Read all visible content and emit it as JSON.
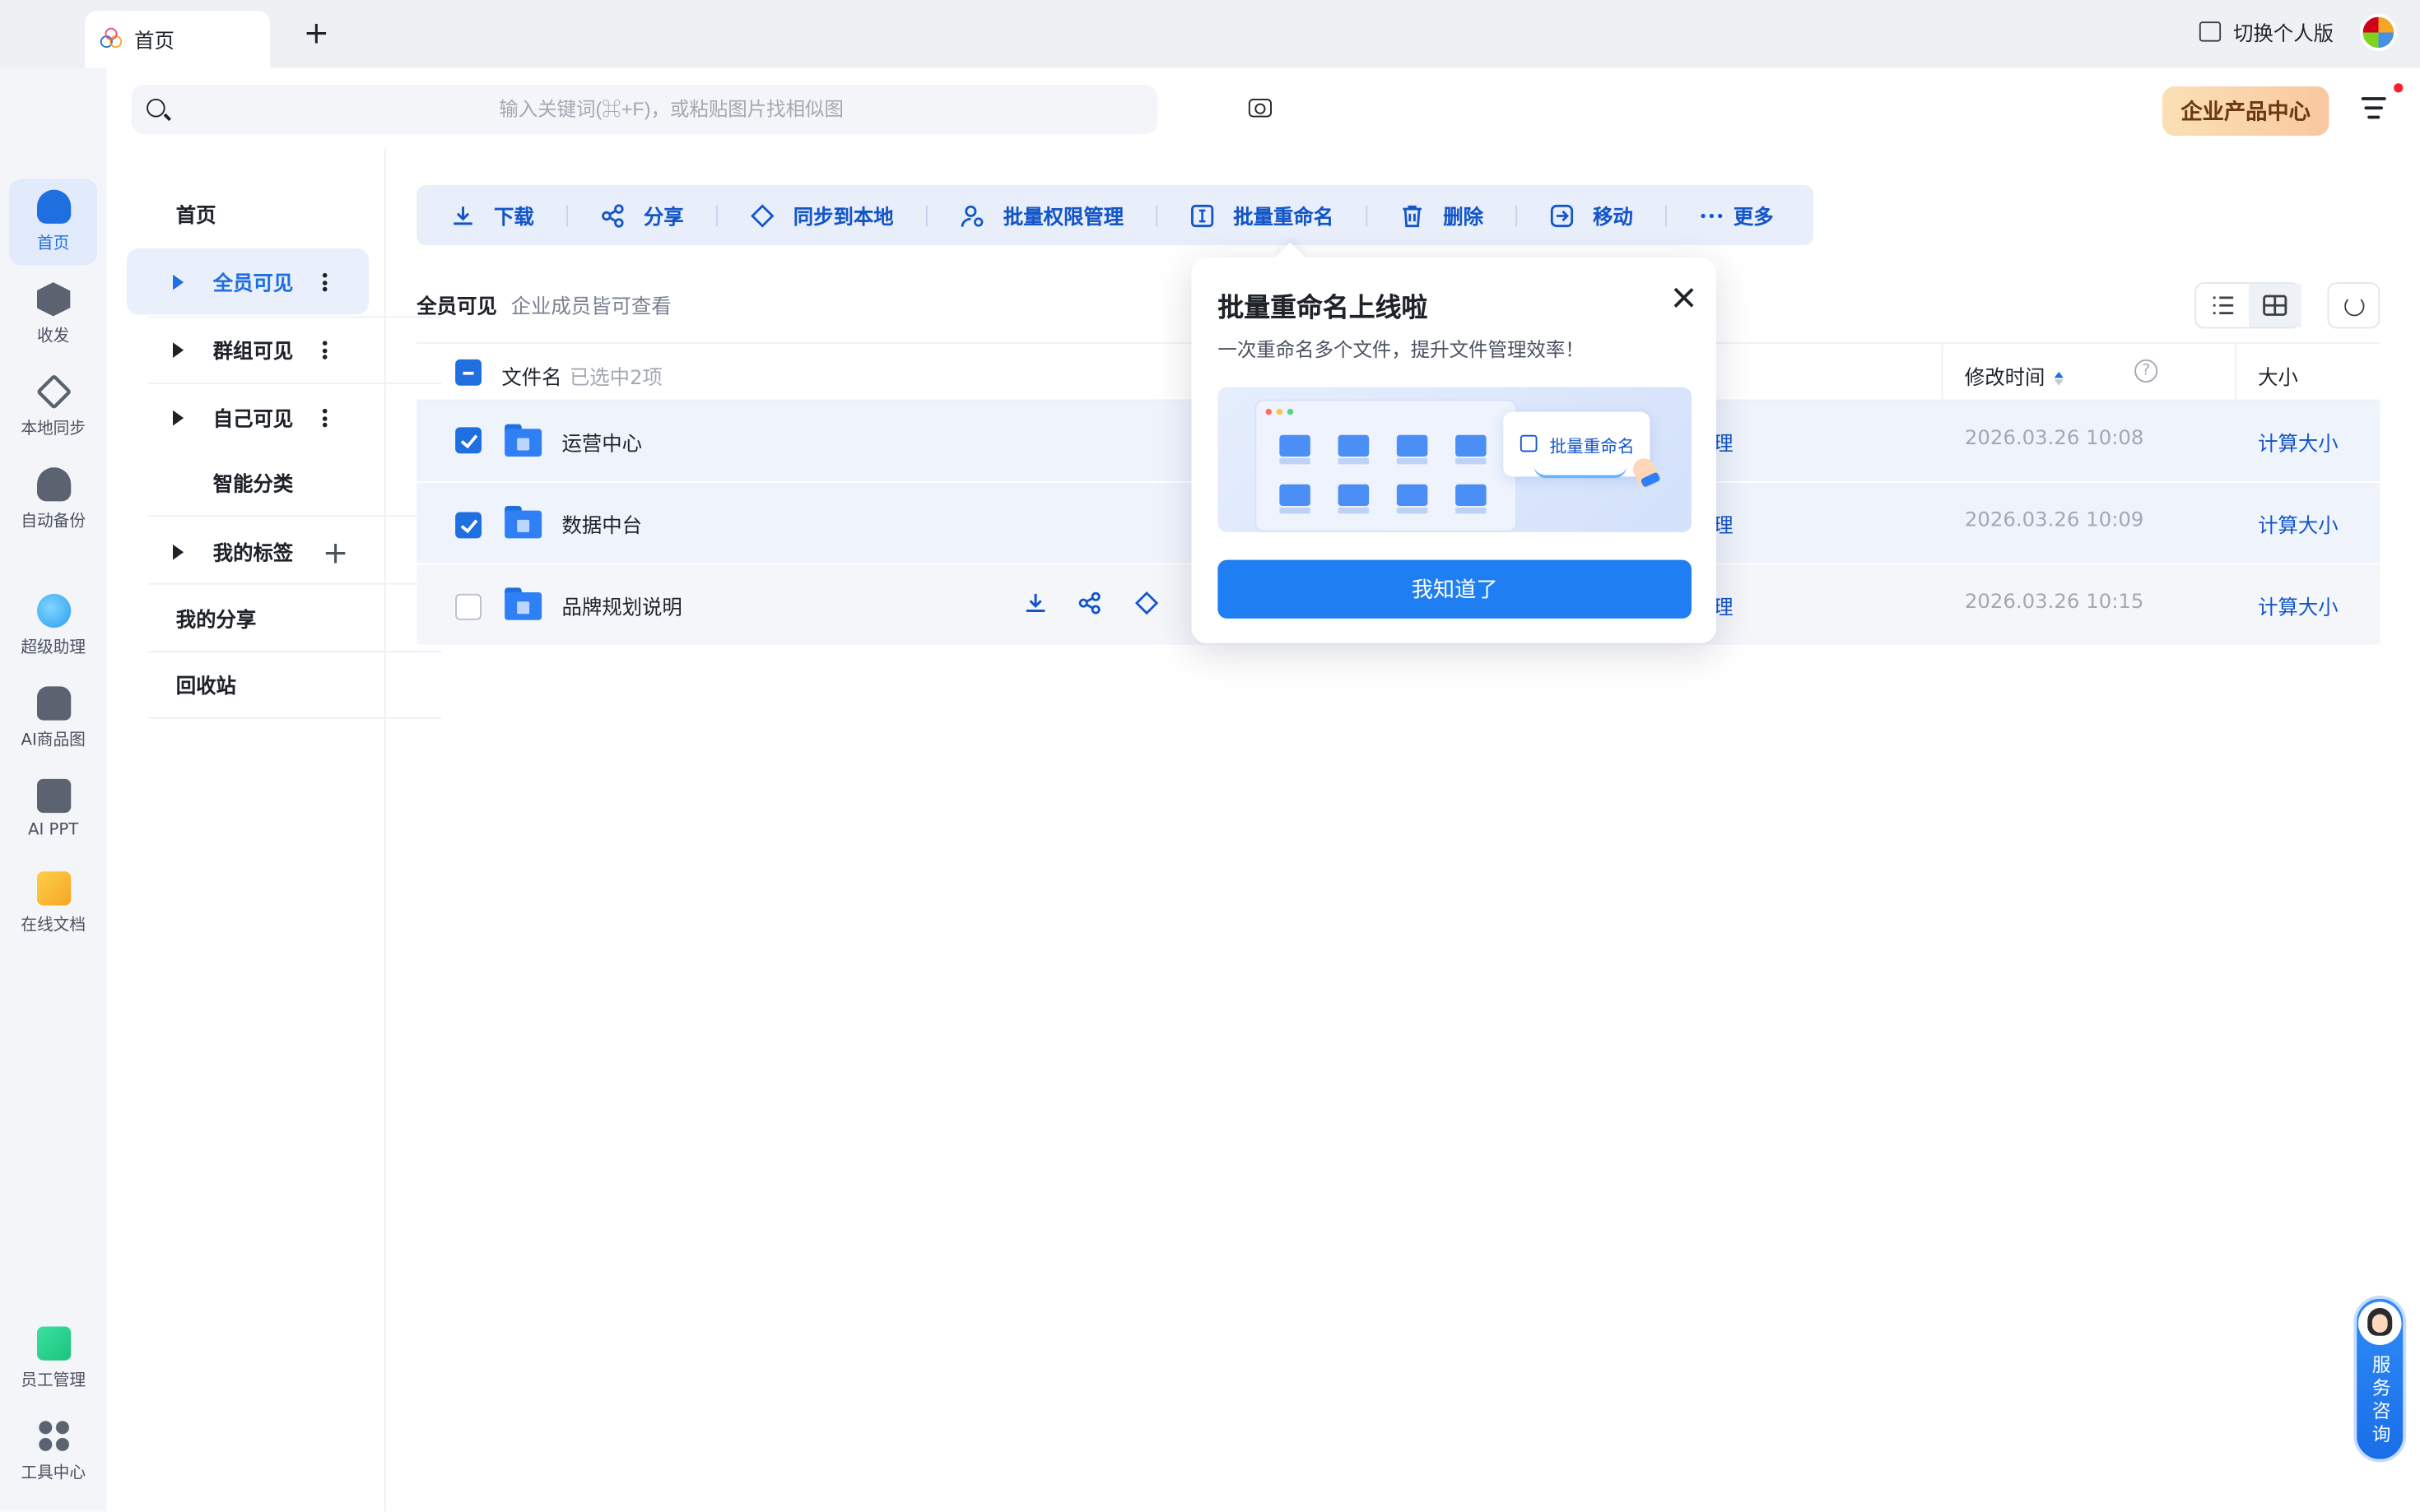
{
  "tabs": [
    {
      "label": "首页"
    }
  ],
  "titlebar": {
    "switch_label": "切换个人版"
  },
  "rail": {
    "items": [
      {
        "label": "首页",
        "icon": "home-icon",
        "color": "#1f6fe0"
      },
      {
        "label": "收发",
        "icon": "transfer-icon",
        "color": "#4a5160"
      },
      {
        "label": "本地同步",
        "icon": "sync-icon",
        "color": "#4a5160"
      },
      {
        "label": "自动备份",
        "icon": "backup-cloud-icon",
        "color": "#4a5160"
      },
      {
        "label": "超级助理",
        "icon": "assistant-icon",
        "color": "#2fb6f5"
      },
      {
        "label": "AI商品图",
        "icon": "shopping-bag-icon",
        "color": "#4a5160"
      },
      {
        "label": "AI PPT",
        "icon": "ppt-icon",
        "color": "#4a5160"
      },
      {
        "label": "在线文档",
        "icon": "doc-icon",
        "color": "#f5a623"
      },
      {
        "label": "员工管理",
        "icon": "staff-icon",
        "color": "#19c37d"
      },
      {
        "label": "工具中心",
        "icon": "grid-icon",
        "color": "#4a5160"
      }
    ]
  },
  "search": {
    "placeholder": "输入关键词(⌘+F)，或粘贴图片找相似图"
  },
  "header": {
    "enterprise_center": "企业产品中心"
  },
  "subnav": {
    "home": "首页",
    "everyone": "全员可见",
    "group": "群组可见",
    "self": "自己可见",
    "smart": "智能分类",
    "tags": "我的标签",
    "share": "我的分享",
    "trash": "回收站"
  },
  "toolbar": {
    "download": "下载",
    "share": "分享",
    "sync": "同步到本地",
    "permissions": "批量权限管理",
    "rename": "批量重命名",
    "delete": "删除",
    "move": "移动",
    "more": "更多"
  },
  "section": {
    "title": "全员可见",
    "subtitle": "企业成员皆可查看"
  },
  "table": {
    "headers": {
      "name": "文件名",
      "selected": "已选中2项",
      "mtime": "修改时间",
      "size": "大小"
    },
    "rows": [
      {
        "name": "运营中心",
        "cut": "理",
        "mtime": "2026.03.26 10:08",
        "size": "计算大小",
        "checked": true
      },
      {
        "name": "数据中台",
        "cut": "理",
        "mtime": "2026.03.26 10:09",
        "size": "计算大小",
        "checked": true
      },
      {
        "name": "品牌规划说明",
        "cut": "理",
        "mtime": "2026.03.26 10:15",
        "size": "计算大小",
        "checked": false
      }
    ]
  },
  "popover": {
    "title": "批量重命名上线啦",
    "desc": "一次重命名多个文件，提升文件管理效率！",
    "art_tag": "批量重命名",
    "button": "我知道了"
  },
  "service": {
    "label": "服务咨询"
  },
  "colors": {
    "accent": "#1f6fe0",
    "toolbar_bg": "#e8eefa",
    "selected_row": "#eef3fc"
  }
}
